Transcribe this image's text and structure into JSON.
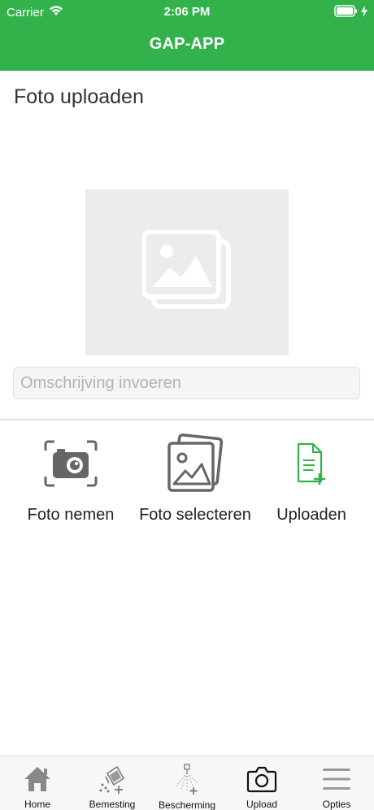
{
  "status_bar": {
    "carrier": "Carrier",
    "time": "2:06 PM"
  },
  "header": {
    "title": "GAP-APP",
    "background_color": "#33b24c"
  },
  "main": {
    "page_title": "Foto uploaden",
    "image_placeholder_icon": "image-placeholder-icon",
    "description_input": {
      "value": "",
      "placeholder": "Omschrijving invoeren"
    },
    "actions": [
      {
        "label": "Foto nemen",
        "icon": "camera-icon"
      },
      {
        "label": "Foto selecteren",
        "icon": "gallery-icon"
      },
      {
        "label": "Uploaden",
        "icon": "upload-file-icon"
      }
    ]
  },
  "tab_bar": {
    "items": [
      {
        "label": "Home",
        "icon": "home-icon"
      },
      {
        "label": "Bemesting",
        "icon": "fertilizer-icon"
      },
      {
        "label": "Bescherming",
        "icon": "sprayer-icon"
      },
      {
        "label": "Upload",
        "icon": "camera-icon",
        "active": true
      },
      {
        "label": "Opties",
        "icon": "menu-icon"
      }
    ]
  }
}
